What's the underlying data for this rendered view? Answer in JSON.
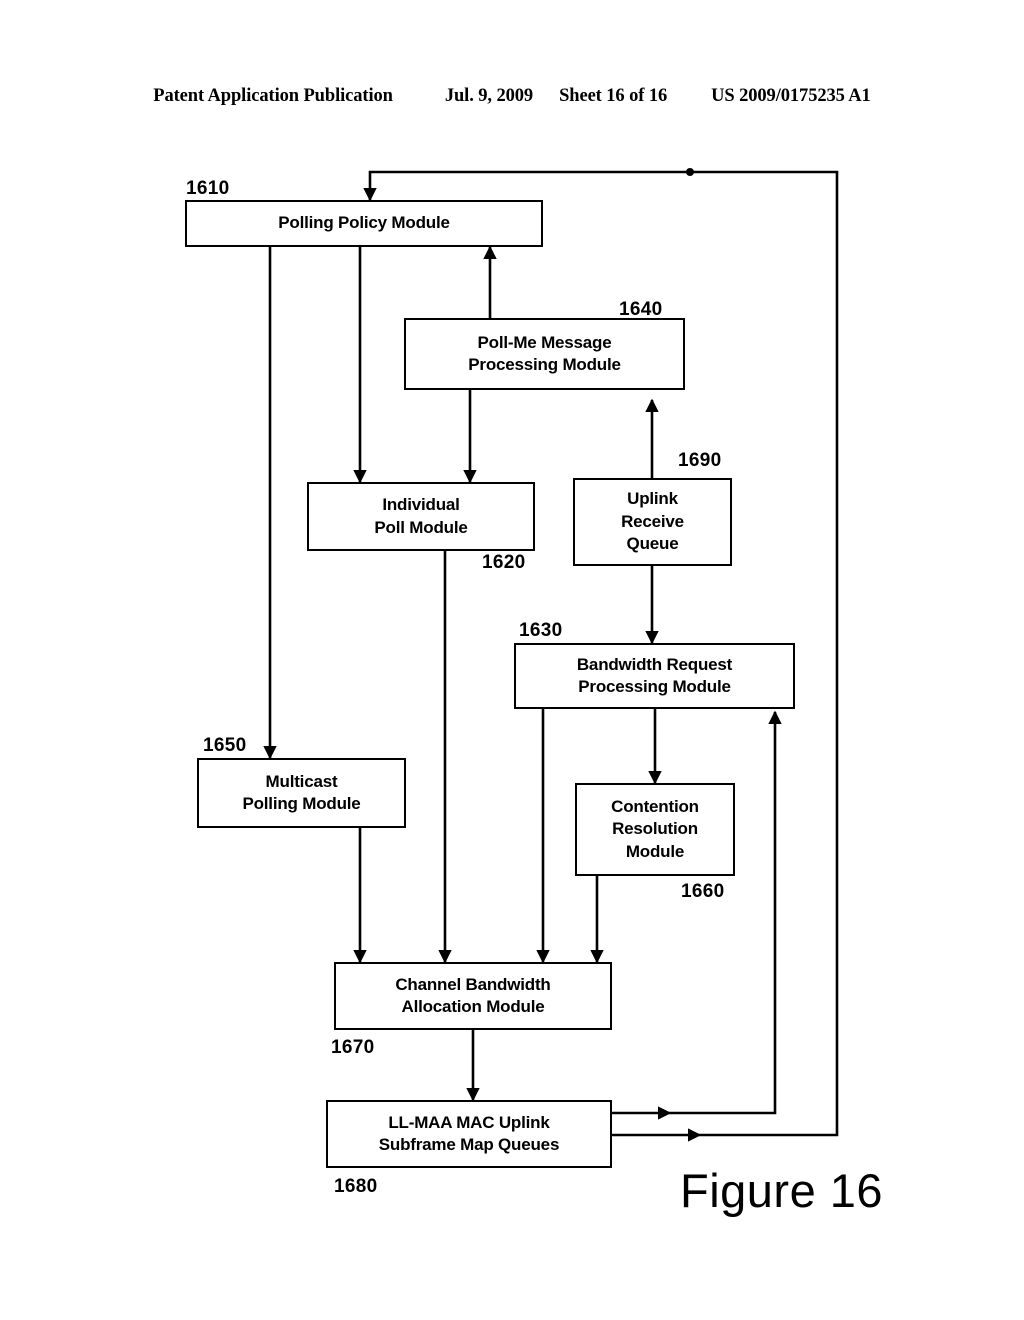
{
  "header": {
    "publication": "Patent Application Publication",
    "date": "Jul. 9, 2009",
    "sheet": "Sheet 16 of 16",
    "patent_number": "US 2009/0175235 A1"
  },
  "figure": {
    "caption": "Figure 16",
    "type": "block-diagram"
  },
  "nodes": [
    {
      "id": "1610",
      "ref": "1610",
      "label": "Polling Policy Module"
    },
    {
      "id": "1640",
      "ref": "1640",
      "label": "Poll-Me Message\nProcessing Module"
    },
    {
      "id": "1620",
      "ref": "1620",
      "label": "Individual\nPoll Module"
    },
    {
      "id": "1690",
      "ref": "1690",
      "label": "Uplink\nReceive\nQueue"
    },
    {
      "id": "1630",
      "ref": "1630",
      "label": "Bandwidth Request\nProcessing Module"
    },
    {
      "id": "1650",
      "ref": "1650",
      "label": "Multicast\nPolling Module"
    },
    {
      "id": "1660",
      "ref": "1660",
      "label": "Contention\nResolution\nModule"
    },
    {
      "id": "1670",
      "ref": "1670",
      "label": "Channel Bandwidth\nAllocation Module"
    },
    {
      "id": "1680",
      "ref": "1680",
      "label": "LL-MAA MAC Uplink\nSubframe Map Queues"
    }
  ],
  "connections": [
    {
      "from": "1680",
      "to": "1610",
      "name": "uplink-map-queues-to-polling-policy"
    },
    {
      "from": "1640",
      "to": "1610",
      "name": "poll-me-to-polling-policy"
    },
    {
      "from": "1610",
      "to": "1650",
      "name": "polling-policy-to-multicast"
    },
    {
      "from": "1610",
      "to": "1620",
      "name": "polling-policy-to-individual-poll"
    },
    {
      "from": "1640",
      "to": "1620",
      "name": "poll-me-to-individual-poll"
    },
    {
      "from": "1690",
      "to": "1640",
      "name": "uplink-queue-to-poll-me"
    },
    {
      "from": "1690",
      "to": "1630",
      "name": "uplink-queue-to-bandwidth-request"
    },
    {
      "from": "1630",
      "to": "1660",
      "name": "bandwidth-request-to-contention"
    },
    {
      "from": "1630",
      "to": "1670",
      "name": "bandwidth-request-to-channel-allocation"
    },
    {
      "from": "1620",
      "to": "1670",
      "name": "individual-poll-to-channel-allocation"
    },
    {
      "from": "1650",
      "to": "1670",
      "name": "multicast-to-channel-allocation"
    },
    {
      "from": "1660",
      "to": "1670",
      "name": "contention-to-channel-allocation"
    },
    {
      "from": "1670",
      "to": "1680",
      "name": "channel-allocation-to-map-queues"
    },
    {
      "from": "1680",
      "to": "1630",
      "name": "map-queues-to-bandwidth-request"
    }
  ],
  "style": {
    "line_color": "#000000",
    "box_fill": "#ffffff",
    "background": "#ffffff"
  }
}
